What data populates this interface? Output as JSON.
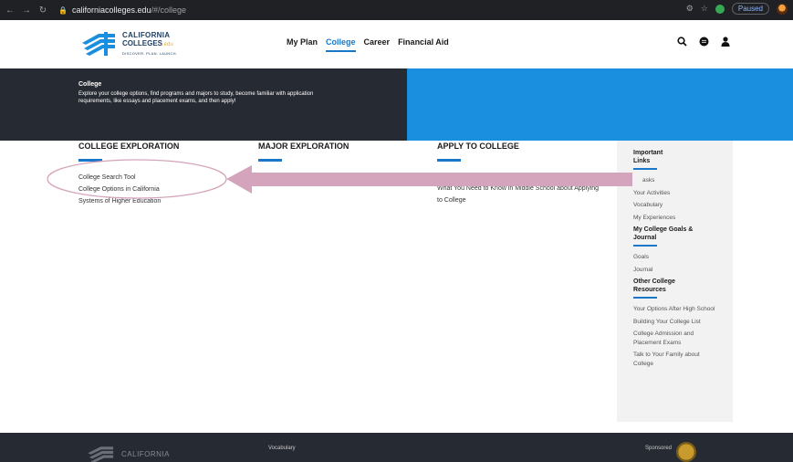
{
  "browser": {
    "url_host": "californiacolleges.edu",
    "url_path": "/#/college",
    "paused_label": "Paused"
  },
  "header": {
    "logo": {
      "line1": "CALIFORNIA",
      "line2": "COLLEGES",
      "edu": ".edu",
      "tagline": "DISCOVER. PLAN. LAUNCH."
    },
    "nav": [
      "My Plan",
      "College",
      "Career",
      "Financial Aid"
    ],
    "active_nav": "College"
  },
  "hero": {
    "title": "College",
    "description": "Explore your college options, find programs and majors to study, become familiar with application requirements, like essays and placement exams, and then apply!"
  },
  "columns": [
    {
      "heading": "COLLEGE EXPLORATION",
      "links": [
        "College Search Tool",
        "College Options in California",
        "Systems of Higher Education"
      ]
    },
    {
      "heading": "MAJOR EXPLORATION",
      "links": []
    },
    {
      "heading": "APPLY TO COLLEGE",
      "links": [
        "What You Need to Know in Middle School about Applying to College"
      ]
    }
  ],
  "sidebar": {
    "sections": [
      {
        "heading": "Important Links",
        "links": [
          "asks",
          "Your Activities",
          "Vocabulary",
          "My Experiences"
        ]
      },
      {
        "heading": "My College Goals & Journal",
        "links": [
          "Goals",
          "Journal"
        ]
      },
      {
        "heading": "Other College Resources",
        "links": [
          "Your Options After High School",
          "Building Your College List",
          "College Admission and Placement Exams",
          "Talk to Your Family about College"
        ]
      }
    ]
  },
  "footer": {
    "logo_text": "CALIFORNIA",
    "link": "Vocabulary",
    "sponsored": "Sponsored"
  },
  "colors": {
    "accent_blue": "#1877c9",
    "hero_dark": "#262a33",
    "hero_blue": "#1a8fe0",
    "annotation_pink": "#d4a4bc"
  }
}
